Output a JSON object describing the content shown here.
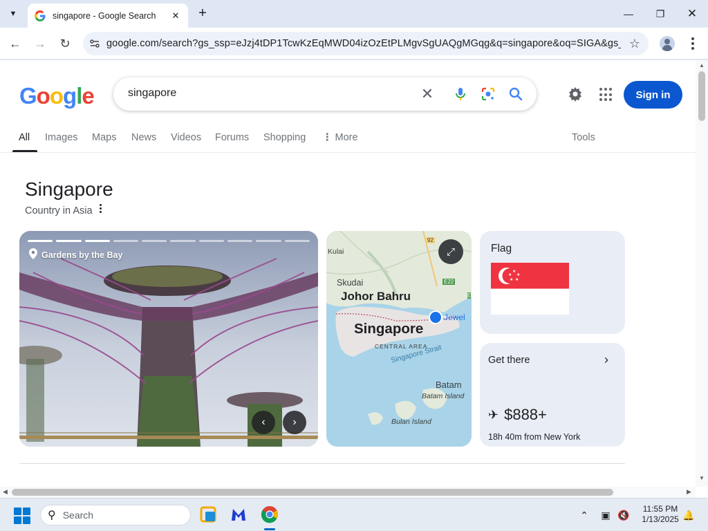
{
  "browser": {
    "tab_title": "singapore - Google Search",
    "url": "google.com/search?gs_ssp=eJzj4tDP1TcwKzEqMWD04izOzEtPLMgvSgUAQgMGqg&q=singapore&oq=SIGA&gs_lcrp..."
  },
  "search": {
    "query": "singapore",
    "signin_label": "Sign in"
  },
  "nav": {
    "tabs": [
      "All",
      "Images",
      "Maps",
      "News",
      "Videos",
      "Forums",
      "Shopping",
      "More"
    ],
    "tools": "Tools",
    "active": "All"
  },
  "knowledge_panel": {
    "title": "Singapore",
    "subtitle": "Country in Asia",
    "photo_location": "Gardens by the Bay",
    "photo_progress": {
      "total": 10,
      "viewed": 3
    },
    "map_labels": {
      "kulai": "Kulai",
      "road_92": "92",
      "skudai": "Skudai",
      "road_e22": "E22",
      "johor_bahru": "Johor Bahru",
      "road_e": "E",
      "jewel": "Jewel",
      "singapore": "Singapore",
      "central_area": "CENTRAL AREA",
      "singapore_strait": "Singapore Strait",
      "batam": "Batam",
      "batam_island": "Batam Island",
      "bulan_island": "Bulan Island"
    },
    "flag_title": "Flag",
    "get_there_title": "Get there",
    "flight_price": "$888+",
    "flight_duration": "18h 40m from New York"
  },
  "taskbar": {
    "search_label": "Search",
    "time": "11:55 PM",
    "date": "1/13/2025"
  },
  "colors": {
    "accent": "#0b57d0",
    "flag_red": "#ef3340",
    "map_water": "#a9d3e8",
    "map_land": "#e4eadb",
    "card_bg": "#e9eef6"
  }
}
